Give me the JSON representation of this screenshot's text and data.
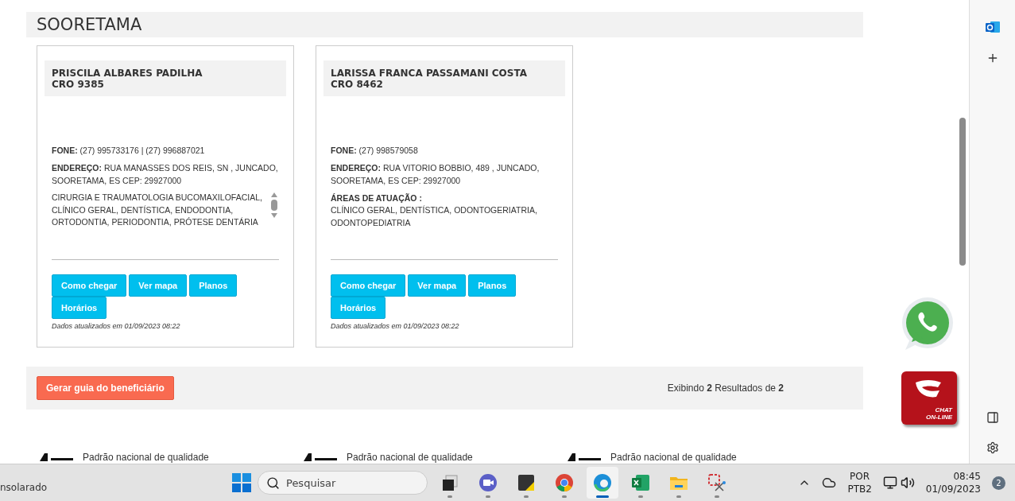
{
  "section": {
    "title": "SOORETAMA"
  },
  "dentists": [
    {
      "name": "PRISCILA ALBARES PADILHA",
      "cro": "CRO 9385",
      "phone_label": "FONE:",
      "phone": "(27) 995733176 | (27) 996887021",
      "address_label": "ENDEREÇO:",
      "address": "RUA MANASSES DOS REIS, SN , JUNCADO, SOORETAMA, ES CEP: 29927000",
      "areas": "CIRURGIA E TRAUMATOLOGIA BUCOMAXILOFACIAL, CLÍNICO GERAL, DENTÍSTICA, ENDODONTIA, ORTODONTIA, PERIODONTIA, PRÓTESE DENTÁRIA",
      "areas_scrollable": true,
      "buttons": [
        "Como chegar",
        "Ver mapa",
        "Planos",
        "Horários"
      ],
      "updated": "Dados atualizados em 01/09/2023 08:22"
    },
    {
      "name": "LARISSA FRANCA PASSAMANI COSTA",
      "cro": "CRO 8462",
      "phone_label": "FONE:",
      "phone": "(27) 998579058",
      "address_label": "ENDEREÇO:",
      "address": "RUA VITORIO BOBBIO, 489 , JUNCADO, SOORETAMA, ES CEP: 29927000",
      "areas_label": "ÁREAS DE ATUAÇÃO :",
      "areas": "CLÍNICO GERAL, DENTÍSTICA, ODONTOGERIATRIA, ODONTOPEDIATRIA",
      "areas_scrollable": false,
      "buttons": [
        "Como chegar",
        "Ver mapa",
        "Planos",
        "Horários"
      ],
      "updated": "Dados atualizados em 01/09/2023 08:22"
    }
  ],
  "footer": {
    "button": "Gerar guia do beneficiário",
    "results": "Exibindo **2** Resultados de **2**"
  },
  "quality_seals": [
    "Padrão nacional de qualidade",
    "Padrão nacional de qualidade",
    "Padrão nacional de qualidade"
  ],
  "chat_badge": {
    "line1": "CHAT",
    "line2": "ON-LINE"
  },
  "taskbar": {
    "window_label": "nsolarado",
    "search_placeholder": "Pesquisar",
    "apps": [
      {
        "kind": "taskview",
        "selected": false
      },
      {
        "kind": "meet",
        "selected": false
      },
      {
        "kind": "notes",
        "selected": false
      },
      {
        "kind": "chrome",
        "selected": false
      },
      {
        "kind": "edge",
        "selected": true
      },
      {
        "kind": "excel",
        "selected": false
      },
      {
        "kind": "folder",
        "selected": false
      },
      {
        "kind": "snip",
        "selected": false
      }
    ],
    "language": "POR",
    "layout": "PTB2",
    "time": "08:45",
    "date": "01/09/2023",
    "notifications": "2"
  }
}
